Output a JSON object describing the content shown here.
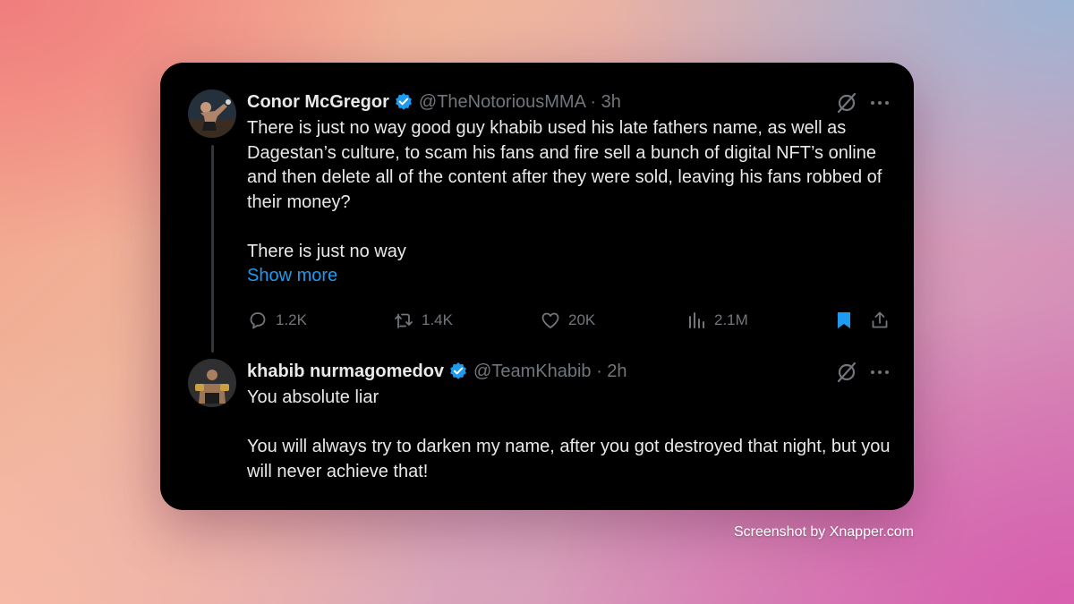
{
  "tweets": [
    {
      "name": "Conor McGregor",
      "handle": "@TheNotoriousMMA · 3h",
      "paragraphs": [
        "There is just no way good guy khabib used his late fathers name, as well as Dagestan’s culture, to scam his fans and fire sell a bunch of digital NFT’s online and then delete all of the content after they were sold, leaving his fans robbed of their money?",
        "There is just no way"
      ],
      "show_more": "Show more",
      "stats": {
        "replies": "1.2K",
        "reposts": "1.4K",
        "likes": "20K",
        "views": "2.1M"
      }
    },
    {
      "name": "khabib nurmagomedov",
      "handle": "@TeamKhabib · 2h",
      "paragraphs": [
        "You absolute liar",
        "You will always try to darken my name, after you got destroyed that night, but you will never achieve that!"
      ]
    }
  ],
  "colors": {
    "verified": "#1d9bf0",
    "link": "#1d9bf0",
    "muted": "#71767b",
    "text": "#e7e9ea",
    "card": "#000000"
  },
  "footer": {
    "watermark": "Screenshot by Xnapper.com"
  }
}
